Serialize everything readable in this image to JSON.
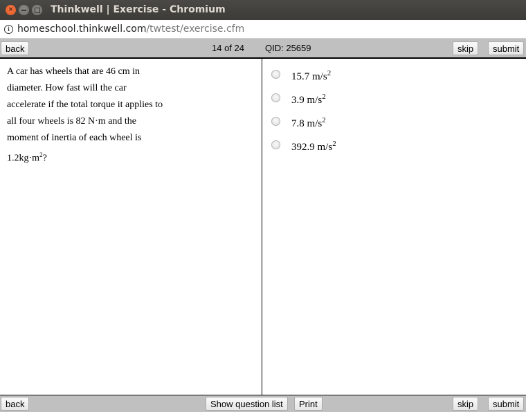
{
  "window": {
    "title": "Thinkwell | Exercise - Chromium",
    "controls": [
      "close-icon",
      "minimize-icon",
      "maximize-icon"
    ]
  },
  "address_bar": {
    "host": "homeschool.thinkwell.com",
    "path": "/twtest/exercise.cfm",
    "icon": "info-icon"
  },
  "top_toolbar": {
    "back_label": "back",
    "progress": "14 of 24",
    "qid": "QID: 25659",
    "skip_label": "skip",
    "submit_label": "submit"
  },
  "question": {
    "lines": [
      "A car has wheels that are 46 cm in",
      "diameter.  How fast will the car",
      "accelerate if the total torque it applies to",
      "all four wheels is 82 N·m and the",
      "moment of inertia of each wheel is",
      "1.2kg·m"
    ],
    "last_line_sup": "2",
    "last_line_suffix": "?"
  },
  "answers": [
    {
      "value": "15.7 m/s",
      "sup": "2",
      "selected": false
    },
    {
      "value": "3.9 m/s",
      "sup": "2",
      "selected": false
    },
    {
      "value": "7.8 m/s",
      "sup": "2",
      "selected": false
    },
    {
      "value": "392.9 m/s",
      "sup": "2",
      "selected": false
    }
  ],
  "bottom_toolbar": {
    "back_label": "back",
    "show_list_label": "Show question list",
    "print_label": "Print",
    "skip_label": "skip",
    "submit_label": "submit"
  }
}
